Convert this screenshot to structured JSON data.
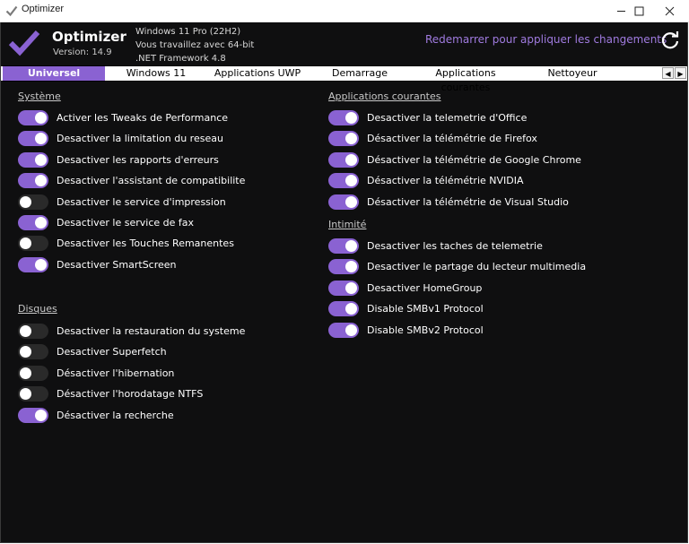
{
  "window": {
    "title": "Optimizer"
  },
  "header": {
    "app_name": "Optimizer",
    "version": "Version: 14.9",
    "sys_info": [
      "Windows 11 Pro (22H2)",
      "Vous travaillez avec 64-bit",
      ".NET Framework 4.8"
    ],
    "restart_label": "Redemarrer pour appliquer les changements",
    "accent_color": "#8a62d2"
  },
  "tabs": [
    {
      "label": "Universel",
      "active": true
    },
    {
      "label": "Windows 11",
      "active": false
    },
    {
      "label": "Applications UWP",
      "active": false
    },
    {
      "label": "Demarrage",
      "active": false
    },
    {
      "label": "Applications courantes",
      "active": false
    },
    {
      "label": "Nettoyeur",
      "active": false
    }
  ],
  "sections": {
    "systeme": {
      "title": "Système",
      "options": [
        {
          "label": "Activer les Tweaks de Performance",
          "on": true
        },
        {
          "label": "Desactiver la limitation du reseau",
          "on": true
        },
        {
          "label": "Desactiver les rapports d'erreurs",
          "on": true
        },
        {
          "label": "Desactiver l'assistant de compatibilite",
          "on": true
        },
        {
          "label": "Desactiver le service d'impression",
          "on": false
        },
        {
          "label": "Desactiver le service de fax",
          "on": true
        },
        {
          "label": "Desactiver les Touches Remanentes",
          "on": false
        },
        {
          "label": "Desactiver SmartScreen",
          "on": true
        }
      ]
    },
    "disques": {
      "title": "Disques",
      "options": [
        {
          "label": "Desactiver la restauration du systeme",
          "on": false
        },
        {
          "label": "Desactiver Superfetch",
          "on": false
        },
        {
          "label": "Désactiver l'hibernation",
          "on": false
        },
        {
          "label": "Désactiver l'horodatage NTFS",
          "on": false
        },
        {
          "label": "Désactiver la recherche",
          "on": true
        }
      ]
    },
    "applications": {
      "title": "Applications courantes",
      "options": [
        {
          "label": "Desactiver la telemetrie d'Office",
          "on": true
        },
        {
          "label": "Désactiver la télémétrie de Firefox",
          "on": true
        },
        {
          "label": "Désactiver la télémétrie de Google Chrome",
          "on": true
        },
        {
          "label": "Désactiver la télémétrie NVIDIA",
          "on": true
        },
        {
          "label": "Désactiver la télémétrie de Visual Studio",
          "on": true
        }
      ]
    },
    "intimite": {
      "title": "Intimité",
      "options": [
        {
          "label": "Desactiver les taches de telemetrie",
          "on": true
        },
        {
          "label": "Desactiver le partage du lecteur multimedia",
          "on": true
        },
        {
          "label": "Desactiver HomeGroup",
          "on": true
        },
        {
          "label": "Disable SMBv1 Protocol",
          "on": true
        },
        {
          "label": "Disable SMBv2 Protocol",
          "on": true
        }
      ]
    }
  }
}
